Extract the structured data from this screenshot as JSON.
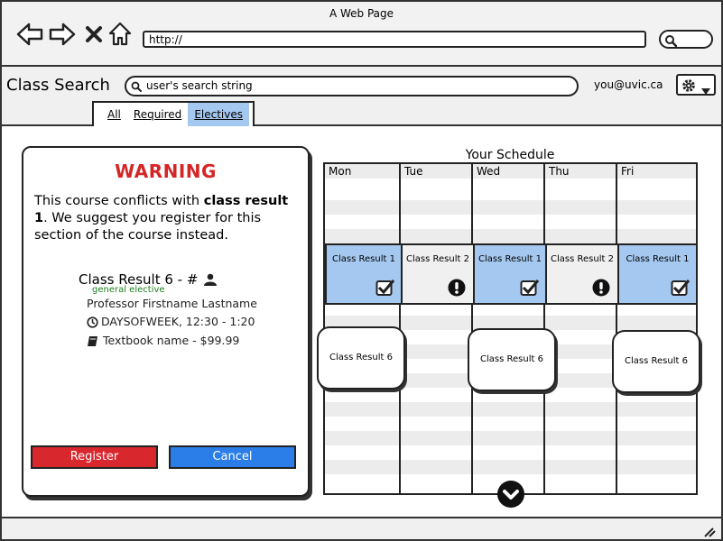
{
  "browser": {
    "window_title": "A Web Page",
    "url": "http://"
  },
  "app": {
    "title": "Class Search",
    "search_value": "user's search string",
    "user_email": "you@uvic.ca",
    "tabs": [
      {
        "label": "All",
        "active": false
      },
      {
        "label": "Required",
        "active": false
      },
      {
        "label": "Electives",
        "active": true
      }
    ]
  },
  "dialog": {
    "title": "WARNING",
    "message_before": "This course conflicts with ",
    "message_bold": "class result 1",
    "message_after": ". We suggest you register for this section of the course instead.",
    "course_title": "Class Result 6 - #",
    "course_type": "general elective",
    "professor": "Professor Firstname Lastname",
    "time": "DAYSOFWEEK, 12:30 - 1:20",
    "textbook": "Textbook name - $99.99",
    "register_label": "Register",
    "cancel_label": "Cancel"
  },
  "schedule": {
    "title": "Your Schedule",
    "days": [
      "Mon",
      "Tue",
      "Wed",
      "Thu",
      "Fri"
    ],
    "slots": [
      {
        "day": "Mon",
        "label": "Class Result 1",
        "status": "ok"
      },
      {
        "day": "Tue",
        "label": "Class Result 2",
        "status": "conflict"
      },
      {
        "day": "Wed",
        "label": "Class Result 1",
        "status": "ok"
      },
      {
        "day": "Thu",
        "label": "Class Result 2",
        "status": "conflict"
      },
      {
        "day": "Fri",
        "label": "Class Result 1",
        "status": "ok"
      }
    ],
    "proposed": [
      {
        "day": "Mon",
        "label": "Class Result 6"
      },
      {
        "day": "Wed",
        "label": "Class Result 6"
      },
      {
        "day": "Fri",
        "label": "Class Result 6"
      }
    ]
  },
  "colors": {
    "selected": "#a5c8f0",
    "warning": "#d42626",
    "register": "#d9272e",
    "cancel": "#2b7de8"
  },
  "icons": [
    "back-arrow-icon",
    "forward-arrow-icon",
    "close-icon",
    "home-icon",
    "search-icon",
    "gear-icon",
    "chevron-down-icon",
    "users-icon",
    "clock-icon",
    "book-icon",
    "checkbox-checked-icon",
    "exclamation-icon",
    "resize-grip-icon"
  ]
}
